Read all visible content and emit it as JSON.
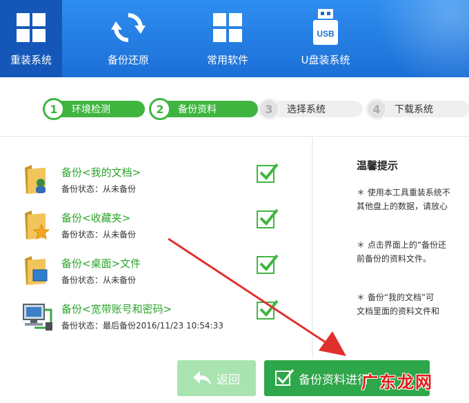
{
  "nav": {
    "items": [
      {
        "label": "重装系统",
        "icon": "windows-icon"
      },
      {
        "label": "备份还原",
        "icon": "refresh-icon"
      },
      {
        "label": "常用软件",
        "icon": "apps-grid-icon"
      },
      {
        "label": "U盘装系统",
        "icon": "usb-icon",
        "badge": "USB"
      }
    ],
    "active": 0
  },
  "steps": [
    {
      "num": "1",
      "label": "环境检测",
      "state": "done"
    },
    {
      "num": "2",
      "label": "备份资料",
      "state": "done"
    },
    {
      "num": "3",
      "label": "选择系统",
      "state": "todo"
    },
    {
      "num": "4",
      "label": "下载系统",
      "state": "todo"
    }
  ],
  "backup_items": [
    {
      "title": "备份<我的文档>",
      "status": "备份状态：从未备份",
      "icon": "my-documents-folder-icon",
      "checked": true
    },
    {
      "title": "备份<收藏夹>",
      "status": "备份状态：从未备份",
      "icon": "favorites-folder-icon",
      "checked": true
    },
    {
      "title": "备份<桌面>文件",
      "status": "备份状态：从未备份",
      "icon": "desktop-folder-icon",
      "checked": true
    },
    {
      "title": "备份<宽带账号和密码>",
      "status": "备份状态：最后备份2016/11/23 10:54:33",
      "icon": "network-computer-icon",
      "checked": true
    }
  ],
  "tips": {
    "title": "温馨提示",
    "lines": [
      "＊ 使用本工具重装系统不",
      "其他盘上的数据，请放心",
      "＊ 点击界面上的“备份还",
      "前备份的资料文件。",
      "＊ 备份“我的文档”可",
      "文档里面的资料文件和"
    ]
  },
  "buttons": {
    "back": "返回",
    "backup": "备份资料进行"
  },
  "watermark": "广东龙网",
  "colors": {
    "nav_blue": "#1b6fd6",
    "nav_active": "#1557b8",
    "green": "#3fb53f",
    "annotation_arrow": "#e0302c"
  }
}
